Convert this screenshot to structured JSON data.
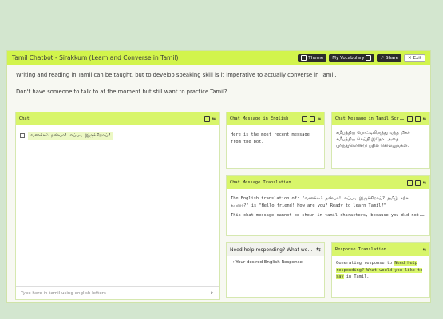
{
  "window": {
    "title": "Tamil Chatbot - Sirakkum (Learn and Converse in Tamil)",
    "actions": [
      {
        "label": "Theme",
        "icon": "theme-icon"
      },
      {
        "label": "My Vocabulary",
        "icon": "book-icon"
      },
      {
        "label": "Share",
        "icon": "share-icon"
      },
      {
        "label": "Exit",
        "icon": "close-icon"
      }
    ]
  },
  "intro": {
    "line1": "Writing and reading in Tamil can be taught, but to develop speaking skill is it imperative to actually converse in Tamil.",
    "line2": "Don't have someone to talk to at the moment but still want to practice Tamil?"
  },
  "chat": {
    "header": "Chat",
    "message": "வணக்கம் நண்பா! எப்படி இருக்கிறாய்?",
    "input_placeholder": "Type here in tamil using english letters"
  },
  "english_panel": {
    "header": "Chat Message in English",
    "body": "Here is the most recent message from the bot."
  },
  "tamil_panel": {
    "header": "Chat Message in Tamil Scr...",
    "body": "சமீபத்திய போட்டிலிருந்து வந்த மிகச் சமீபத்திய செய்தி இதோ. அதை புரிந்துகொண்டு பதில் சொல்லுங்கள்."
  },
  "translation_panel": {
    "header": "Chat Message Translation",
    "line1": "The English translation of: \"வணக்கம் நண்பா! எப்படி இருக்கிறாய்? தமிழ் கற்க தயாரா?\" is \"Hello friend! How are you? Ready to learn Tamil?\"",
    "line2": "This chat message cannot be shown in tamil characters, because you did not..."
  },
  "help_panel": {
    "header": "Need help responding? What would y...",
    "body": "→ Your desired English Response"
  },
  "response_panel": {
    "header": "Response Translation",
    "pre": "Generating response to ",
    "hl": "Need help responding? What would you like to say",
    "post": " in Tamil."
  }
}
